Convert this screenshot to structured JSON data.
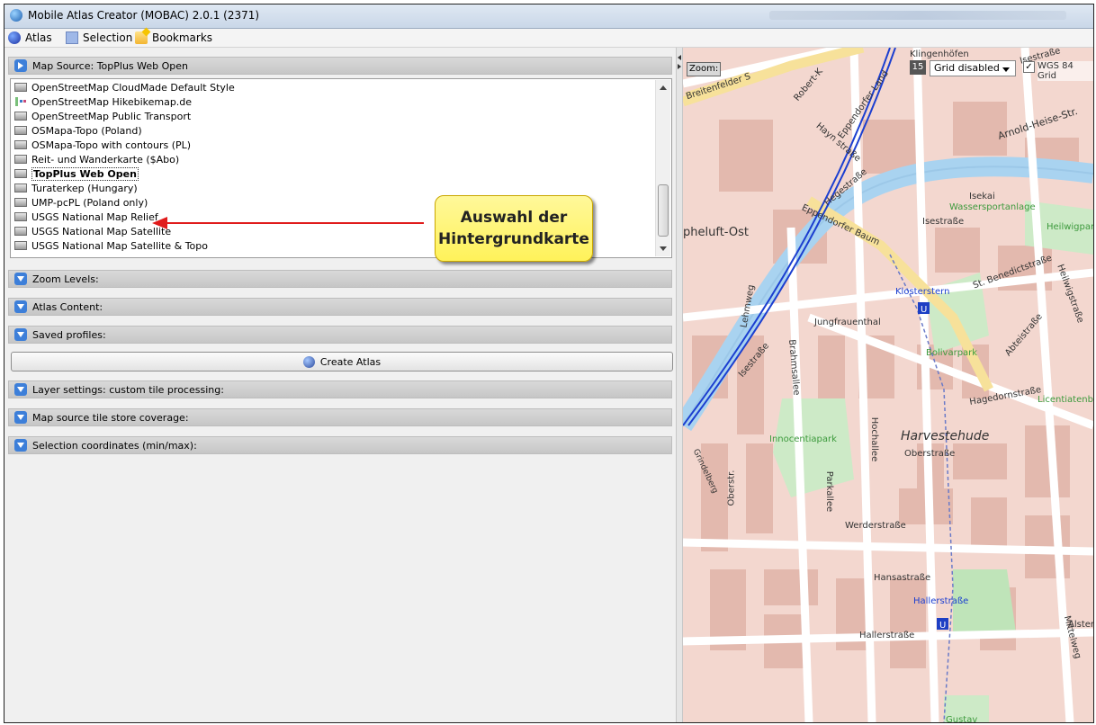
{
  "window": {
    "title": "Mobile Atlas Creator (MOBAC) 2.0.1 (2371)"
  },
  "menubar": {
    "items": [
      {
        "label": "Atlas",
        "icon": "globe-icon"
      },
      {
        "label": "Selection",
        "icon": "selection-icon"
      },
      {
        "label": "Bookmarks",
        "icon": "bookmark-folder-icon"
      }
    ]
  },
  "map_source": {
    "header": "Map Source: TopPlus Web Open",
    "items": [
      {
        "label": "OpenStreetMap CloudMade Default Style",
        "selected": false
      },
      {
        "label": "OpenStreetMap Hikebikemap.de",
        "selected": false
      },
      {
        "label": "OpenStreetMap Public Transport",
        "selected": false
      },
      {
        "label": "OSMapa-Topo (Poland)",
        "selected": false
      },
      {
        "label": "OSMapa-Topo with contours (PL)",
        "selected": false
      },
      {
        "label": "Reit- und Wanderkarte ($Abo)",
        "selected": false
      },
      {
        "label": "TopPlus Web Open",
        "selected": true
      },
      {
        "label": "Turaterkep (Hungary)",
        "selected": false
      },
      {
        "label": "UMP-pcPL (Poland only)",
        "selected": false
      },
      {
        "label": "USGS National Map Relief",
        "selected": false
      },
      {
        "label": "USGS National Map Satellite",
        "selected": false
      },
      {
        "label": "USGS National Map Satellite & Topo",
        "selected": false
      }
    ]
  },
  "panels": {
    "zoom_levels": "Zoom Levels:",
    "atlas_content": "Atlas Content:",
    "saved_profiles": "Saved profiles:",
    "create_atlas": "Create Atlas",
    "layer_settings": "Layer settings: custom tile processing:",
    "tile_store": "Map source tile store coverage:",
    "selection_coords": "Selection coordinates (min/max):"
  },
  "annotation": {
    "line1": "Auswahl der",
    "line2": "Hintergrundkarte",
    "arrow_color": "#e01b1b",
    "bg_color": "#fff25a"
  },
  "map_toolbar": {
    "zoom_label": "Zoom:",
    "zoom_level": "15",
    "grid_select": "Grid disabled",
    "wgs_checked": true,
    "wgs_label": "WGS 84 Grid"
  },
  "map_labels": {
    "districts": [
      "pheluft-Ost",
      "Harvestehude"
    ],
    "streets": [
      "Breitenfelder S",
      "Robert-K",
      "Eppendorfer Land",
      "Klingenhöfen",
      "Isestraße",
      "Arnold-Heise-Str.",
      "Hayn straße",
      "Hegestraße",
      "Eppendorfer Baum",
      "Isestraße",
      "St. Benedictstraße",
      "Heilwigstraße",
      "Jungfrauenthal",
      "Lehmweg",
      "Isestraße",
      "Brahmsallee",
      "Abteistraße",
      "Hagedornstraße",
      "Hochallee",
      "Oberstraße",
      "Parkallee",
      "Oberstr.",
      "Werderstraße",
      "Hansastraße",
      "Hallerstraße",
      "Mittelweg",
      "Alster",
      "Grindelberg"
    ],
    "parks": [
      "Isekai",
      "Wassersportanlage",
      "Heilwigpark",
      "Bolivarpark",
      "Innocentiapark",
      "Licentiatenberg",
      "Gustav"
    ],
    "stations": [
      "Klosterstern",
      "Hallerstraße"
    ]
  }
}
